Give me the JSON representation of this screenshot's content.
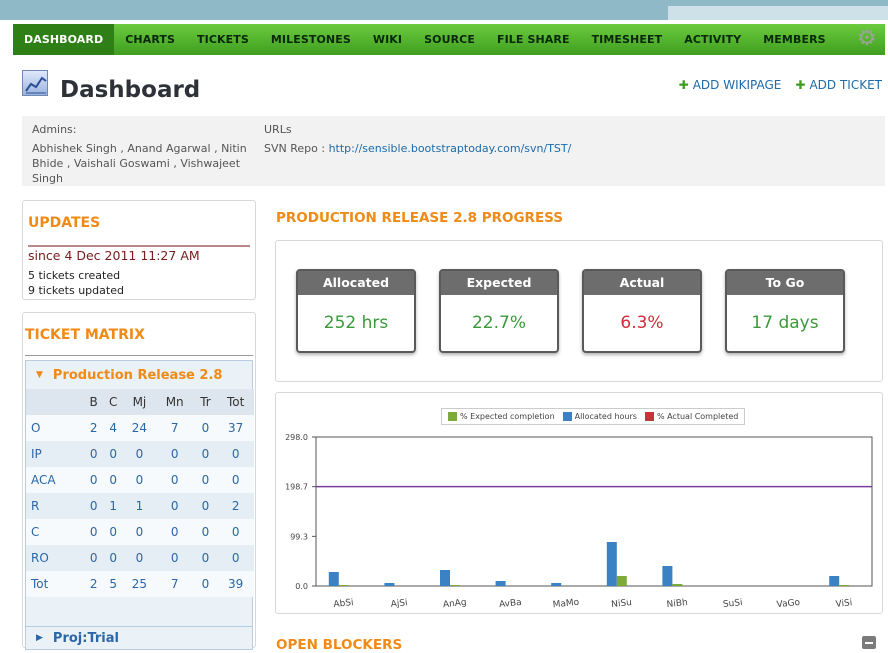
{
  "nav": {
    "items": [
      "DASHBOARD",
      "CHARTS",
      "TICKETS",
      "MILESTONES",
      "WIKI",
      "SOURCE",
      "FILE SHARE",
      "TIMESHEET",
      "ACTIVITY",
      "MEMBERS"
    ],
    "active": "DASHBOARD",
    "settings_icon": "gear-icon"
  },
  "header": {
    "title": "Dashboard",
    "icon": "chart-icon",
    "add_wikipage": "ADD WIKIPAGE",
    "add_ticket": "ADD TICKET"
  },
  "info": {
    "admins_label": "Admins:",
    "admins": "Abhishek Singh , Anand Agarwal , Nitin Bhide , Vaishali Goswami , Vishwajeet Singh",
    "urls_label": "URLs",
    "svn_label": "SVN Repo :",
    "svn_url": "http://sensible.bootstraptoday.com/svn/TST/"
  },
  "updates": {
    "title": "UPDATES",
    "since": "since 4 Dec 2011 11:27 AM",
    "created": "5 tickets created",
    "updated": "9 tickets updated"
  },
  "matrix": {
    "title": "TICKET MATRIX",
    "release": "Production Release 2.8",
    "columns": [
      "",
      "B",
      "C",
      "Mj",
      "Mn",
      "Tr",
      "Tot"
    ],
    "rows": [
      {
        "label": "O",
        "values": [
          "2",
          "4",
          "24",
          "7",
          "0",
          "37"
        ]
      },
      {
        "label": "IP",
        "values": [
          "0",
          "0",
          "0",
          "0",
          "0",
          "0"
        ]
      },
      {
        "label": "ACA",
        "values": [
          "0",
          "0",
          "0",
          "0",
          "0",
          "0"
        ]
      },
      {
        "label": "R",
        "values": [
          "0",
          "1",
          "1",
          "0",
          "0",
          "2"
        ]
      },
      {
        "label": "C",
        "values": [
          "0",
          "0",
          "0",
          "0",
          "0",
          "0"
        ]
      },
      {
        "label": "RO",
        "values": [
          "0",
          "0",
          "0",
          "0",
          "0",
          "0"
        ]
      },
      {
        "label": "Tot",
        "values": [
          "2",
          "5",
          "25",
          "7",
          "0",
          "39"
        ]
      }
    ],
    "collapsed_project": "Proj:Trial"
  },
  "progress": {
    "title": "PRODUCTION RELEASE 2.8 PROGRESS",
    "cards": [
      {
        "label": "Allocated",
        "value": "252 hrs",
        "color": "#3a9a3a"
      },
      {
        "label": "Expected",
        "value": "22.7%",
        "color": "#3a9a3a"
      },
      {
        "label": "Actual",
        "value": "6.3%",
        "color": "#d02a3a"
      },
      {
        "label": "To Go",
        "value": "17 days",
        "color": "#3a9a3a"
      }
    ]
  },
  "chart_data": {
    "type": "bar",
    "categories": [
      "AbSi",
      "AjSi",
      "AnAg",
      "AvBa",
      "MaMo",
      "NiSu",
      "NiBh",
      "SuSi",
      "VaGo",
      "ViSi"
    ],
    "series": [
      {
        "name": "% Expected completion",
        "color": "#7cab3c",
        "values": [
          2,
          0,
          2,
          0,
          0,
          20,
          4,
          0,
          0,
          2
        ]
      },
      {
        "name": "Allocated hours",
        "color": "#3b82c4",
        "values": [
          28,
          6,
          32,
          10,
          6,
          88,
          40,
          0,
          0,
          20
        ]
      },
      {
        "name": "% Actual Completed",
        "color": "#c2363a",
        "values": [
          0,
          0,
          0,
          0,
          0,
          0,
          0,
          0,
          0,
          0
        ]
      }
    ],
    "yticks": [
      "0.0",
      "99.3",
      "198.7",
      "298.0"
    ],
    "ylim": [
      0,
      298
    ],
    "reference_line": 198.7,
    "reference_color": "#7a3f9e",
    "legend_position": "top"
  },
  "blockers": {
    "title": "OPEN BLOCKERS"
  }
}
